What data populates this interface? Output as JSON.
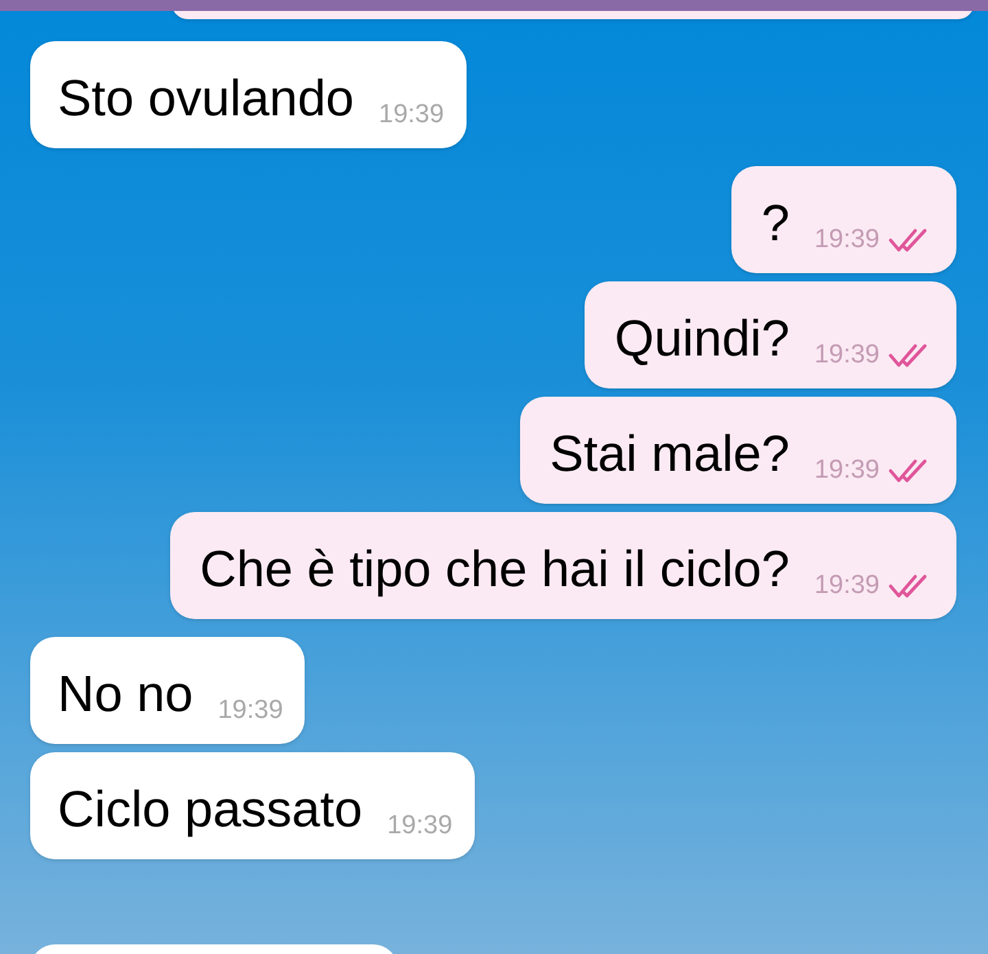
{
  "messages": [
    {
      "kind": "incoming",
      "text": "Sto ovulando",
      "time": "19:39"
    },
    {
      "kind": "outgoing",
      "text": "?",
      "time": "19:39",
      "read": true
    },
    {
      "kind": "outgoing",
      "text": "Quindi?",
      "time": "19:39",
      "read": true
    },
    {
      "kind": "outgoing",
      "text": "Stai male?",
      "time": "19:39",
      "read": true
    },
    {
      "kind": "outgoing",
      "text": "Che è tipo che hai il ciclo?",
      "time": "19:39",
      "read": true
    },
    {
      "kind": "incoming",
      "text": "No no",
      "time": "19:39"
    },
    {
      "kind": "incoming",
      "text": "Ciclo passato",
      "time": "19:39"
    }
  ]
}
